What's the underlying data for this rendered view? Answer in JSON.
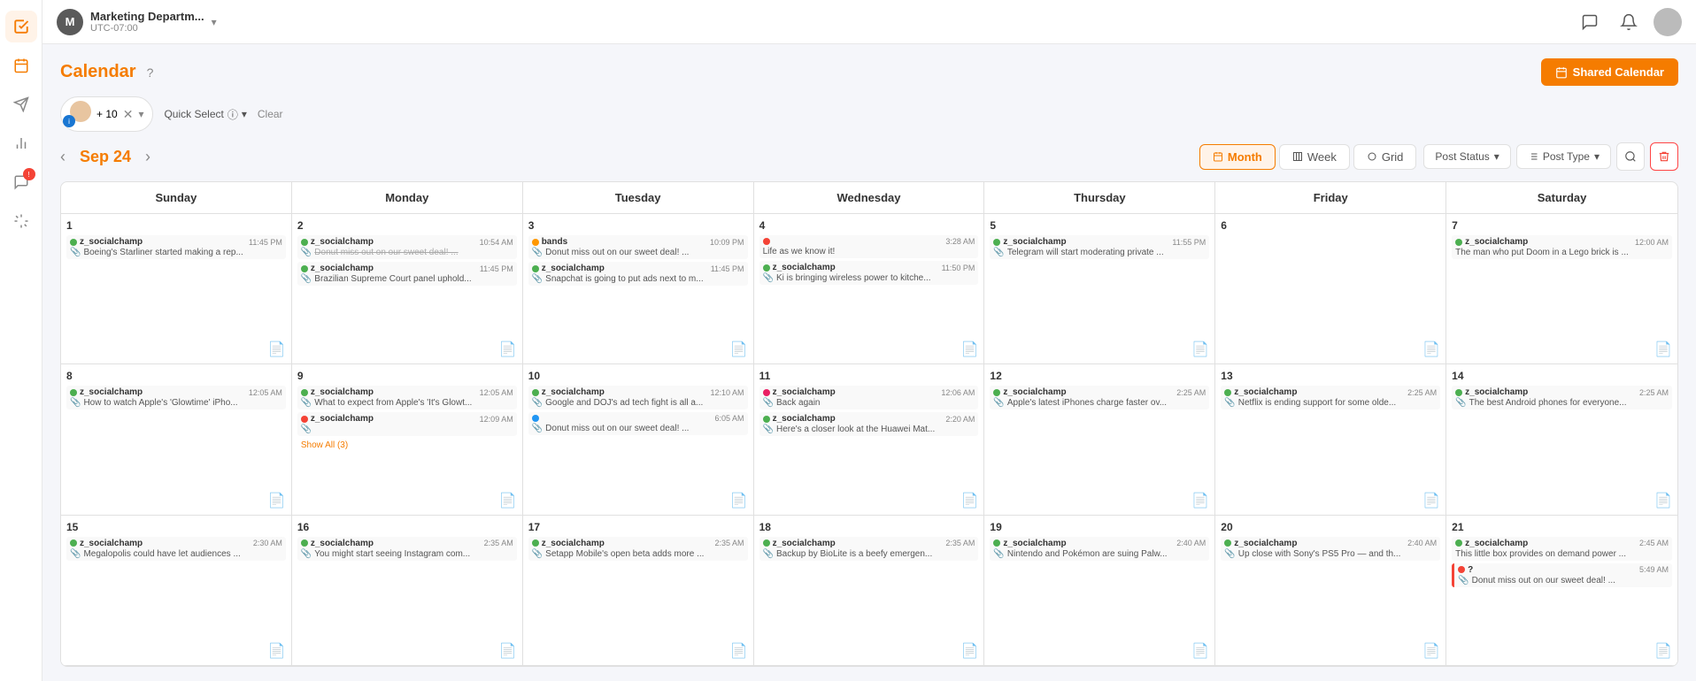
{
  "sidebar": {
    "icons": [
      {
        "name": "check-icon",
        "symbol": "✓",
        "active": true
      },
      {
        "name": "calendar-icon",
        "symbol": "📅",
        "active": true,
        "activeOrange": true
      },
      {
        "name": "send-icon",
        "symbol": "➤"
      },
      {
        "name": "chart-icon",
        "symbol": "📊"
      },
      {
        "name": "chat-icon",
        "symbol": "💬",
        "badge": "!"
      },
      {
        "name": "audio-icon",
        "symbol": "🎙"
      }
    ]
  },
  "topbar": {
    "brand_initial": "M",
    "brand_name": "Marketing Departm...",
    "brand_tz": "UTC-07:00",
    "dropdown_symbol": "▾"
  },
  "header": {
    "title": "Calendar",
    "help_symbol": "?",
    "shared_cal_label": "Shared Calendar",
    "cal_icon": "📅"
  },
  "filters": {
    "plus_count": "+ 10",
    "quick_select": "Quick Select",
    "clear": "Clear"
  },
  "nav": {
    "prev": "‹",
    "next": "›",
    "current_date": "Sep 24",
    "views": [
      {
        "label": "Month",
        "icon": "📅",
        "active": true
      },
      {
        "label": "Week",
        "icon": "⊞"
      },
      {
        "label": "Grid",
        "icon": "⬤"
      }
    ],
    "filter_post_status": "Post Status",
    "filter_post_type": "Post Type"
  },
  "calendar": {
    "days": [
      "Sunday",
      "Monday",
      "Tuesday",
      "Wednesday",
      "Thursday",
      "Friday",
      "Saturday"
    ],
    "weeks": [
      {
        "cells": [
          {
            "day": "1",
            "events": [
              {
                "user": "z_socialchamp",
                "time": "11:45 PM",
                "title": "Boeing's Starliner started making a rep...",
                "color": "green",
                "icon": "📎"
              }
            ]
          },
          {
            "day": "2",
            "events": [
              {
                "user": "z_socialchamp",
                "time": "10:54 AM",
                "title": "Donut miss out on our sweet deal! ...",
                "color": "green",
                "icon": "📎",
                "strikethrough": true
              },
              {
                "user": "z_socialchamp",
                "time": "11:45 PM",
                "title": "Brazilian Supreme Court panel uphold...",
                "color": "green",
                "icon": "📎"
              }
            ]
          },
          {
            "day": "3",
            "events": [
              {
                "user": "bands",
                "time": "10:09 PM",
                "title": "Donut miss out on our sweet deal! ...",
                "color": "orange",
                "icon": "📎"
              },
              {
                "user": "z_socialchamp",
                "time": "11:45 PM",
                "title": "Snapchat is going to put ads next to m...",
                "color": "green",
                "icon": "📎"
              }
            ]
          },
          {
            "day": "4",
            "events": [
              {
                "user": "",
                "time": "3:28 AM",
                "title": "Life as we know it!",
                "color": "red",
                "dot_red": true
              },
              {
                "user": "z_socialchamp",
                "time": "11:50 PM",
                "title": "Ki is bringing wireless power to kitche...",
                "color": "green",
                "icon": "📎"
              }
            ]
          },
          {
            "day": "5",
            "events": [
              {
                "user": "z_socialchamp",
                "time": "11:55 PM",
                "title": "Telegram will start moderating private ...",
                "color": "green",
                "icon": "📎"
              }
            ]
          },
          {
            "day": "6",
            "events": []
          },
          {
            "day": "7",
            "events": [
              {
                "user": "z_socialchamp",
                "time": "12:00 AM",
                "title": "The man who put Doom in a Lego brick is ...",
                "color": "green"
              }
            ]
          }
        ]
      },
      {
        "cells": [
          {
            "day": "8",
            "events": [
              {
                "user": "z_socialchamp",
                "time": "12:05 AM",
                "title": "How to watch Apple's 'Glowtime' iPho...",
                "color": "green",
                "icon": "📎"
              }
            ]
          },
          {
            "day": "9",
            "events": [
              {
                "user": "z_socialchamp",
                "time": "12:05 AM",
                "title": "What to expect from Apple's 'It's Glowt...",
                "color": "green",
                "icon": "📎"
              },
              {
                "user": "z_socialchamp",
                "time": "12:09 AM",
                "title": "",
                "color": "red",
                "dot_red": true
              },
              {
                "show_all": "Show All (3)"
              }
            ]
          },
          {
            "day": "10",
            "events": [
              {
                "user": "z_socialchamp",
                "time": "12:10 AM",
                "title": "Google and DOJ's ad tech fight is all a...",
                "color": "green",
                "icon": "📎"
              },
              {
                "user": "",
                "time": "6:05 AM",
                "title": "Donut miss out on our sweet deal! ...",
                "color": "blue",
                "dot_blue": true
              }
            ]
          },
          {
            "day": "11",
            "events": [
              {
                "user": "z_socialchamp",
                "time": "12:06 AM",
                "title": "Back again",
                "color": "pink",
                "dot_pink": true
              },
              {
                "user": "z_socialchamp",
                "time": "2:20 AM",
                "title": "Here's a closer look at the Huawei Mat...",
                "color": "green",
                "icon": "📎"
              }
            ]
          },
          {
            "day": "12",
            "events": [
              {
                "user": "z_socialchamp",
                "time": "2:25 AM",
                "title": "Apple's latest iPhones charge faster ov...",
                "color": "green",
                "icon": "📎"
              }
            ]
          },
          {
            "day": "13",
            "events": [
              {
                "user": "z_socialchamp",
                "time": "2:25 AM",
                "title": "Netflix is ending support for some olde...",
                "color": "green",
                "icon": "📎"
              }
            ]
          },
          {
            "day": "14",
            "events": [
              {
                "user": "z_socialchamp",
                "time": "2:25 AM",
                "title": "The best Android phones for everyone...",
                "color": "green",
                "icon": "📎"
              }
            ]
          }
        ]
      },
      {
        "cells": [
          {
            "day": "15",
            "events": [
              {
                "user": "z_socialchamp",
                "time": "2:30 AM",
                "title": "Megalopolis could have let audiences ...",
                "color": "green",
                "icon": "📎"
              }
            ]
          },
          {
            "day": "16",
            "events": [
              {
                "user": "z_socialchamp",
                "time": "2:35 AM",
                "title": "You might start seeing Instagram com...",
                "color": "green",
                "icon": "📎"
              }
            ]
          },
          {
            "day": "17",
            "events": [
              {
                "user": "z_socialchamp",
                "time": "2:35 AM",
                "title": "Setapp Mobile's open beta adds more ...",
                "color": "green",
                "icon": "📎"
              }
            ]
          },
          {
            "day": "18",
            "events": [
              {
                "user": "z_socialchamp",
                "time": "2:35 AM",
                "title": "Backup by BioLite is a beefy emergen...",
                "color": "green",
                "icon": "📎"
              }
            ]
          },
          {
            "day": "19",
            "events": [
              {
                "user": "z_socialchamp",
                "time": "2:40 AM",
                "title": "Nintendo and Pokémon are suing Palw...",
                "color": "green",
                "icon": "📎"
              }
            ]
          },
          {
            "day": "20",
            "events": [
              {
                "user": "z_socialchamp",
                "time": "2:40 AM",
                "title": "Up close with Sony's PS5 Pro — and th...",
                "color": "green",
                "icon": "📎"
              }
            ]
          },
          {
            "day": "21",
            "events": [
              {
                "user": "z_socialchamp",
                "time": "2:45 AM",
                "title": "This little box provides on demand power ...",
                "color": "green"
              },
              {
                "user": "?",
                "time": "5:49 AM",
                "title": "Donut miss out on our sweet deal! ...",
                "color": "red",
                "dot_red": true
              }
            ]
          }
        ]
      }
    ]
  }
}
